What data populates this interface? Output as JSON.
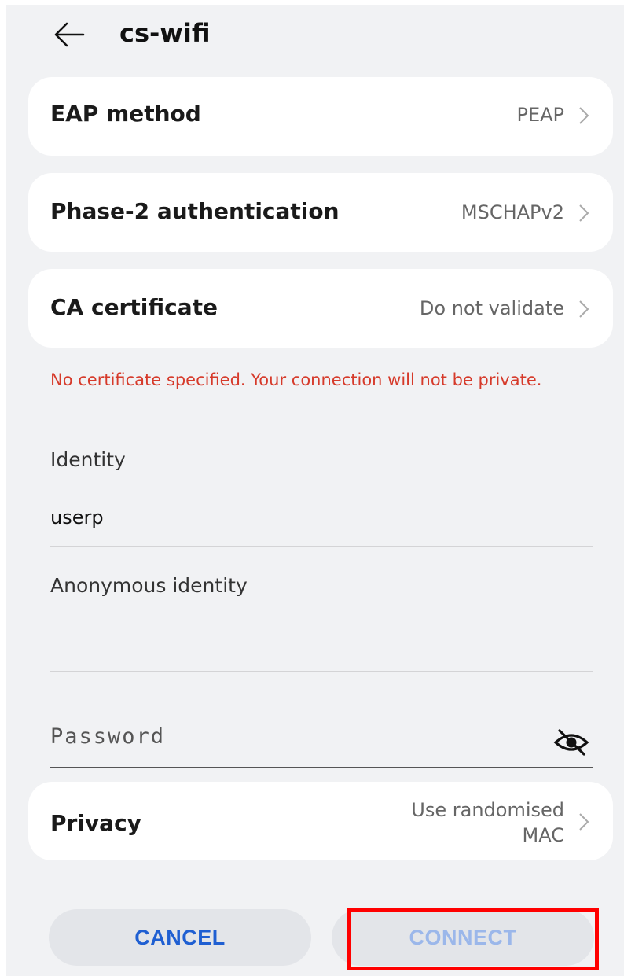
{
  "header": {
    "title": "cs-wifi"
  },
  "settings": {
    "eap_method": {
      "label": "EAP method",
      "value": "PEAP"
    },
    "phase2": {
      "label": "Phase-2 authentication",
      "value": "MSCHAPv2"
    },
    "ca_certificate": {
      "label": "CA certificate",
      "value": "Do not validate"
    }
  },
  "warning": "No certificate specified. Your connection will not be private.",
  "identity": {
    "label": "Identity",
    "value": "userp"
  },
  "anonymous_identity": {
    "label": "Anonymous identity",
    "value": ""
  },
  "password": {
    "placeholder": "Password",
    "value": ""
  },
  "privacy": {
    "label": "Privacy",
    "value_line1": "Use randomised",
    "value_line2": "MAC"
  },
  "buttons": {
    "cancel": "CANCEL",
    "connect": "CONNECT"
  },
  "colors": {
    "background": "#f1f2f4",
    "card": "#ffffff",
    "warning": "#d63a2a",
    "cancel_text": "#1f5fd2",
    "connect_text_disabled": "#9bb7ea",
    "highlight": "#ff0000"
  },
  "icons": {
    "back": "arrow-left-icon",
    "chevron": "chevron-right-icon",
    "password_visibility": "eye-off-icon"
  }
}
